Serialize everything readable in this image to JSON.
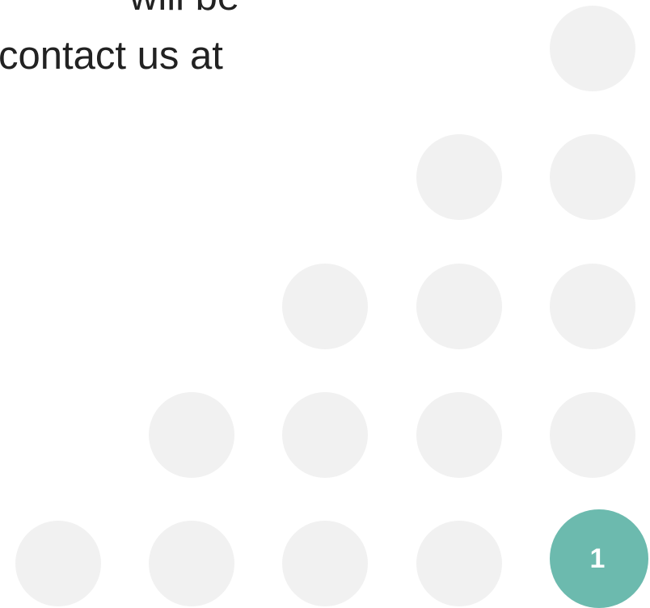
{
  "body_text": {
    "lines": [
      "will be",
      "contact us at"
    ]
  },
  "page_badge": {
    "number": "1",
    "color": "#6cbaae"
  },
  "decoration": {
    "dot_color": "#f1f1f1"
  }
}
